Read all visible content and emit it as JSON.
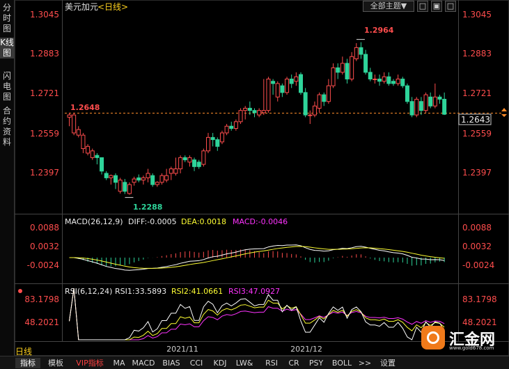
{
  "side_tabs": [
    "分时图",
    "K线图",
    "闪电图",
    "合约资料"
  ],
  "chart_title": {
    "symbol": "美元加元",
    "period_tag": "<日线>"
  },
  "toolbar": {
    "theme_label": "全部主题▼",
    "b1": "□",
    "b2": "▣",
    "b3": "□"
  },
  "price_axis": [
    "1.3045",
    "1.2883",
    "1.2721",
    "1.2559",
    "1.2397"
  ],
  "price_markers": {
    "current_left": "1.2648",
    "current_right": "1.2643",
    "high": "1.2964",
    "low": "1.2288"
  },
  "macd": {
    "title": "MACD(26,12,9)",
    "diff": "DIFF:-0.0005",
    "dea": "DEA:0.0018",
    "macd": "MACD:-0.0046",
    "axis": [
      "0.0088",
      "0.0032",
      "-0.0024"
    ]
  },
  "rsi": {
    "title": "RSI(6,12,24)",
    "rsi1": "RSI1:33.5893",
    "rsi2": "RSI2:41.0661",
    "rsi3": "RSI3:47.0927",
    "axis": [
      "83.1798",
      "48.2021"
    ]
  },
  "date_labels": [
    "2021/11",
    "2021/12"
  ],
  "period_label": "日线",
  "bottom_tabs": [
    "指标",
    "模板",
    "VIP指标",
    "MA",
    "MACD",
    "BIAS",
    "CCI",
    "KDJ",
    "LW&",
    "RSI",
    "CR",
    "PSY",
    "BOLL",
    ">>",
    "设置"
  ],
  "logo": {
    "text": "汇金网",
    "url": "www.gold678.com"
  },
  "colors": {
    "up": "#ff4d4d",
    "down": "#2ed49a",
    "diff": "#ffffff",
    "dea": "#ffff33",
    "rsi3": "#ff33ff"
  },
  "chart_data": {
    "type": "candlestick",
    "ylim": [
      1.2228,
      1.309
    ],
    "candles": [
      [
        1.263,
        1.264,
        1.259,
        1.265
      ],
      [
        1.256,
        1.264,
        1.255,
        1.265
      ],
      [
        1.255,
        1.2575,
        1.254,
        1.259
      ],
      [
        1.249,
        1.255,
        1.247,
        1.256
      ],
      [
        1.247,
        1.25,
        1.246,
        1.251
      ],
      [
        1.245,
        1.248,
        1.244,
        1.249
      ],
      [
        1.246,
        1.245,
        1.242,
        1.247
      ],
      [
        1.245,
        1.239,
        1.2375,
        1.245
      ],
      [
        1.238,
        1.236,
        1.235,
        1.239
      ],
      [
        1.236,
        1.237,
        1.233,
        1.2375
      ],
      [
        1.237,
        1.234,
        1.231,
        1.238
      ],
      [
        1.23,
        1.235,
        1.229,
        1.236
      ],
      [
        1.234,
        1.23,
        1.2288,
        1.2355
      ],
      [
        1.229,
        1.233,
        1.2285,
        1.234
      ],
      [
        1.234,
        1.2355,
        1.2325,
        1.2365
      ],
      [
        1.236,
        1.235,
        1.234,
        1.2375
      ],
      [
        1.235,
        1.236,
        1.233,
        1.237
      ],
      [
        1.236,
        1.238,
        1.234,
        1.24
      ],
      [
        1.237,
        1.233,
        1.232,
        1.238
      ],
      [
        1.233,
        1.234,
        1.232,
        1.2345
      ],
      [
        1.234,
        1.237,
        1.233,
        1.238
      ],
      [
        1.235,
        1.237,
        1.234,
        1.24
      ],
      [
        1.238,
        1.24,
        1.235,
        1.241
      ],
      [
        1.238,
        1.24,
        1.237,
        1.245
      ],
      [
        1.24,
        1.245,
        1.238,
        1.246
      ],
      [
        1.245,
        1.244,
        1.243,
        1.246
      ],
      [
        1.243,
        1.245,
        1.241,
        1.246
      ],
      [
        1.244,
        1.241,
        1.239,
        1.245
      ],
      [
        1.243,
        1.241,
        1.24,
        1.244
      ],
      [
        1.242,
        1.248,
        1.241,
        1.249
      ],
      [
        1.248,
        1.254,
        1.247,
        1.256
      ],
      [
        1.254,
        1.253,
        1.25,
        1.256
      ],
      [
        1.253,
        1.25,
        1.248,
        1.254
      ],
      [
        1.252,
        1.256,
        1.251,
        1.257
      ],
      [
        1.256,
        1.259,
        1.255,
        1.26
      ],
      [
        1.259,
        1.258,
        1.257,
        1.261
      ],
      [
        1.258,
        1.261,
        1.257,
        1.262
      ],
      [
        1.261,
        1.266,
        1.26,
        1.267
      ],
      [
        1.266,
        1.267,
        1.262,
        1.268
      ],
      [
        1.267,
        1.266,
        1.264,
        1.27
      ],
      [
        1.266,
        1.265,
        1.263,
        1.267
      ],
      [
        1.264,
        1.266,
        1.263,
        1.267
      ],
      [
        1.265,
        1.266,
        1.264,
        1.28
      ],
      [
        1.266,
        1.28,
        1.265,
        1.281
      ],
      [
        1.279,
        1.278,
        1.273,
        1.28
      ],
      [
        1.272,
        1.278,
        1.27,
        1.279
      ],
      [
        1.277,
        1.274,
        1.272,
        1.278
      ],
      [
        1.274,
        1.28,
        1.273,
        1.281
      ],
      [
        1.28,
        1.278,
        1.276,
        1.282
      ],
      [
        1.279,
        1.281,
        1.277,
        1.283
      ],
      [
        1.282,
        1.274,
        1.273,
        1.283
      ],
      [
        1.274,
        1.264,
        1.263,
        1.276
      ],
      [
        1.264,
        1.264,
        1.26,
        1.266
      ],
      [
        1.264,
        1.268,
        1.263,
        1.27
      ],
      [
        1.267,
        1.273,
        1.265,
        1.274
      ],
      [
        1.273,
        1.27,
        1.268,
        1.274
      ],
      [
        1.27,
        1.277,
        1.269,
        1.28
      ],
      [
        1.277,
        1.285,
        1.276,
        1.287
      ],
      [
        1.285,
        1.283,
        1.28,
        1.287
      ],
      [
        1.283,
        1.287,
        1.282,
        1.29
      ],
      [
        1.287,
        1.28,
        1.278,
        1.289
      ],
      [
        1.28,
        1.29,
        1.279,
        1.292
      ],
      [
        1.289,
        1.294,
        1.288,
        1.296
      ],
      [
        1.294,
        1.291,
        1.289,
        1.2964
      ],
      [
        1.291,
        1.283,
        1.282,
        1.293
      ],
      [
        1.283,
        1.28,
        1.279,
        1.285
      ],
      [
        1.28,
        1.28,
        1.278,
        1.282
      ],
      [
        1.28,
        1.279,
        1.277,
        1.282
      ],
      [
        1.279,
        1.281,
        1.278,
        1.283
      ],
      [
        1.281,
        1.278,
        1.277,
        1.283
      ],
      [
        1.279,
        1.278,
        1.277,
        1.28
      ],
      [
        1.278,
        1.28,
        1.277,
        1.282
      ],
      [
        1.28,
        1.277,
        1.276,
        1.281
      ],
      [
        1.277,
        1.27,
        1.269,
        1.278
      ],
      [
        1.27,
        1.264,
        1.263,
        1.272
      ],
      [
        1.264,
        1.271,
        1.263,
        1.272
      ],
      [
        1.27,
        1.266,
        1.264,
        1.272
      ],
      [
        1.266,
        1.273,
        1.265,
        1.274
      ],
      [
        1.272,
        1.268,
        1.267,
        1.274
      ],
      [
        1.268,
        1.272,
        1.267,
        1.278
      ],
      [
        1.272,
        1.271,
        1.269,
        1.273
      ],
      [
        1.271,
        1.2643,
        1.264,
        1.274
      ]
    ]
  }
}
